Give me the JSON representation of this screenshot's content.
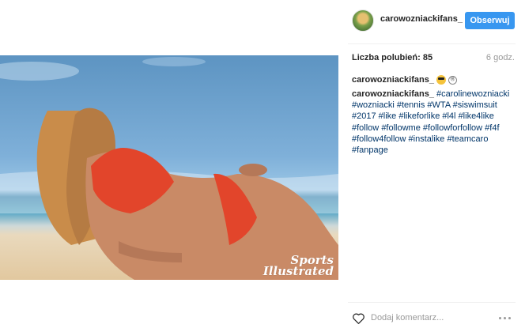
{
  "header": {
    "username": "carowozniackifans_",
    "follow_label": "Obserwuj"
  },
  "stats": {
    "likes_label": "Liczba polubień: 85",
    "time_ago": "6 godz."
  },
  "caption": {
    "username": "carowozniackifans_",
    "emojis": [
      "sunglasses-emoji",
      "symbol-emoji"
    ]
  },
  "comment": {
    "username": "carowozniackifans_",
    "hashtags": [
      "#carolinewozniacki",
      "#wozniacki",
      "#tennis",
      "#WTA",
      "#siswimsuit",
      "#2017",
      "#like",
      "#likeforlike",
      "#l4l",
      "#like4like",
      "#follow",
      "#followme",
      "#followforfollow",
      "#f4f",
      "#follow4follow",
      "#instalike",
      "#teamcaro",
      "#fanpage"
    ]
  },
  "photo": {
    "watermark_line1": "Sports",
    "watermark_line2": "Illustrated"
  },
  "footer": {
    "comment_placeholder": "Dodaj komentarz..."
  },
  "colors": {
    "accent": "#3897f0",
    "link": "#003569",
    "muted": "#999999"
  }
}
